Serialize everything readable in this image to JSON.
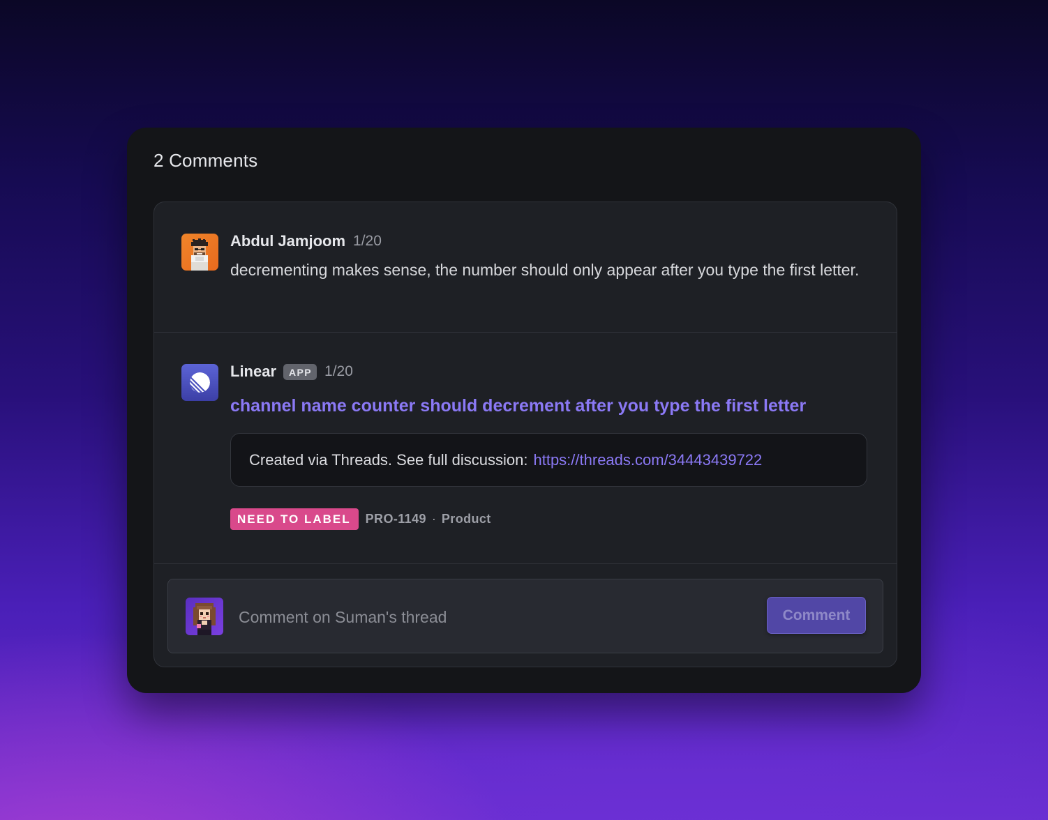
{
  "thread": {
    "count_title": "2 Comments"
  },
  "comments": [
    {
      "author": "Abdul Jamjoom",
      "time": "1/20",
      "text": "decrementing makes sense, the number should only appear after you type the first letter."
    },
    {
      "author": "Linear",
      "badge": "APP",
      "time": "1/20",
      "issue_title": "channel name counter should decrement after you type the first letter",
      "description_prefix": "Created via Threads. See full discussion:",
      "description_link": "https://threads.com/34443439722",
      "label": "NEED TO LABEL",
      "issue_id": "PRO-1149",
      "separator": "·",
      "team": "Product"
    }
  ],
  "composer": {
    "placeholder": "Comment on Suman's thread",
    "value": "",
    "button_label": "Comment"
  },
  "colors": {
    "accent": "#8b79f5",
    "label_pink": "#d9498b",
    "card_bg": "#141518",
    "panel_bg": "#1e2025"
  },
  "icons": {
    "user_avatar": "pixel-avatar-abdul",
    "linear_logo": "linear-logo-icon",
    "composer_avatar": "pixel-avatar-suman"
  }
}
